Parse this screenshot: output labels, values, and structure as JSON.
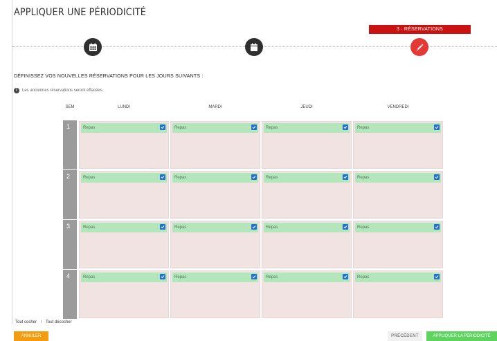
{
  "page": {
    "title": "APPLIQUER UNE PÉRIODICITÉ"
  },
  "stepper": {
    "active_label": "3 · RÉSERVATIONS",
    "steps": [
      {
        "icon": "calendar-grid-icon"
      },
      {
        "icon": "calendar-icon"
      },
      {
        "icon": "pencil-icon"
      }
    ]
  },
  "content": {
    "heading": "DÉFINISSEZ VOS NOUVELLES RÉSERVATIONS POUR LES JOURS SUIVANTS :",
    "info": "Les anciennes réservations seront effacées."
  },
  "grid": {
    "week_header": "SEM",
    "days": [
      "LUNDI",
      "MARDI",
      "JEUDI",
      "VENDREDI"
    ],
    "weeks": [
      {
        "number": "1",
        "slots": [
          {
            "label": "Repas",
            "checked": true
          },
          {
            "label": "Repas",
            "checked": true
          },
          {
            "label": "Repas",
            "checked": true
          },
          {
            "label": "Repas",
            "checked": true
          }
        ]
      },
      {
        "number": "2",
        "slots": [
          {
            "label": "Repas",
            "checked": true
          },
          {
            "label": "Repas",
            "checked": true
          },
          {
            "label": "Repas",
            "checked": true
          },
          {
            "label": "Repas",
            "checked": true
          }
        ]
      },
      {
        "number": "3",
        "slots": [
          {
            "label": "Repas",
            "checked": true
          },
          {
            "label": "Repas",
            "checked": true
          },
          {
            "label": "Repas",
            "checked": true
          },
          {
            "label": "Repas",
            "checked": true
          }
        ]
      },
      {
        "number": "4",
        "slots": [
          {
            "label": "Repas",
            "checked": true
          },
          {
            "label": "Repas",
            "checked": true
          },
          {
            "label": "Repas",
            "checked": true
          },
          {
            "label": "Repas",
            "checked": true
          }
        ]
      }
    ]
  },
  "footer": {
    "check_all": "Tout cocher",
    "separator": "/",
    "uncheck_all": "Tout décocher",
    "cancel": "ANNULER",
    "previous": "PRÉCÉDENT",
    "apply": "APPLIQUER LA PÉRIODICITÉ"
  },
  "colors": {
    "accent_red": "#c91212",
    "slot_green": "#b3e6bb",
    "cell_pink": "#f2e3e3",
    "checkbox_blue": "#1f6fd6",
    "cancel_orange": "#f39c12",
    "apply_green": "#5fd35f"
  }
}
